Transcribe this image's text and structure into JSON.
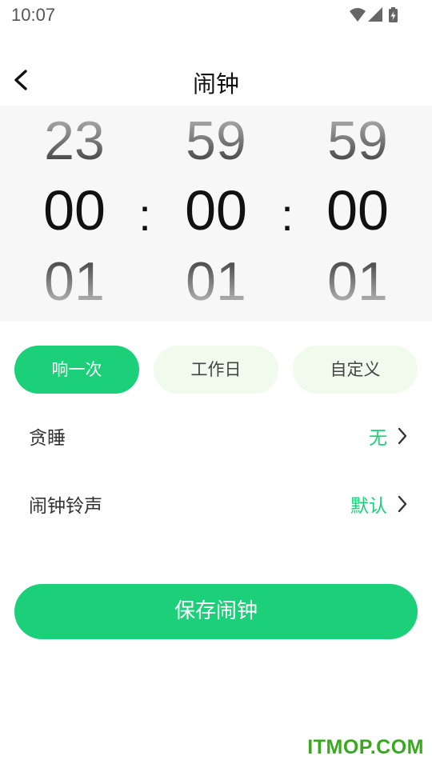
{
  "status_bar": {
    "time": "10:07",
    "icons": [
      "wifi-icon",
      "signal-icon",
      "battery-charging-icon"
    ]
  },
  "header": {
    "back_icon": "chevron-left-icon",
    "title": "闹钟"
  },
  "picker": {
    "hours": {
      "prev": "23",
      "current": "00",
      "next": "01"
    },
    "minutes": {
      "prev": "59",
      "current": "00",
      "next": "01"
    },
    "seconds": {
      "prev": "59",
      "current": "00",
      "next": "01"
    },
    "separator": ":"
  },
  "repeat_options": [
    {
      "label": "响一次",
      "selected": true
    },
    {
      "label": "工作日",
      "selected": false
    },
    {
      "label": "自定义",
      "selected": false
    }
  ],
  "settings": {
    "snooze": {
      "label": "贪睡",
      "value": "无"
    },
    "ringtone": {
      "label": "闹钟铃声",
      "value": "默认"
    }
  },
  "save_button": {
    "label": "保存闹钟"
  },
  "watermark": "ITMOP.COM",
  "colors": {
    "accent": "#1ccf79",
    "pill_inactive_bg": "#f0fbee",
    "picker_bg": "#f7f7f7",
    "watermark": "#3aa820"
  }
}
